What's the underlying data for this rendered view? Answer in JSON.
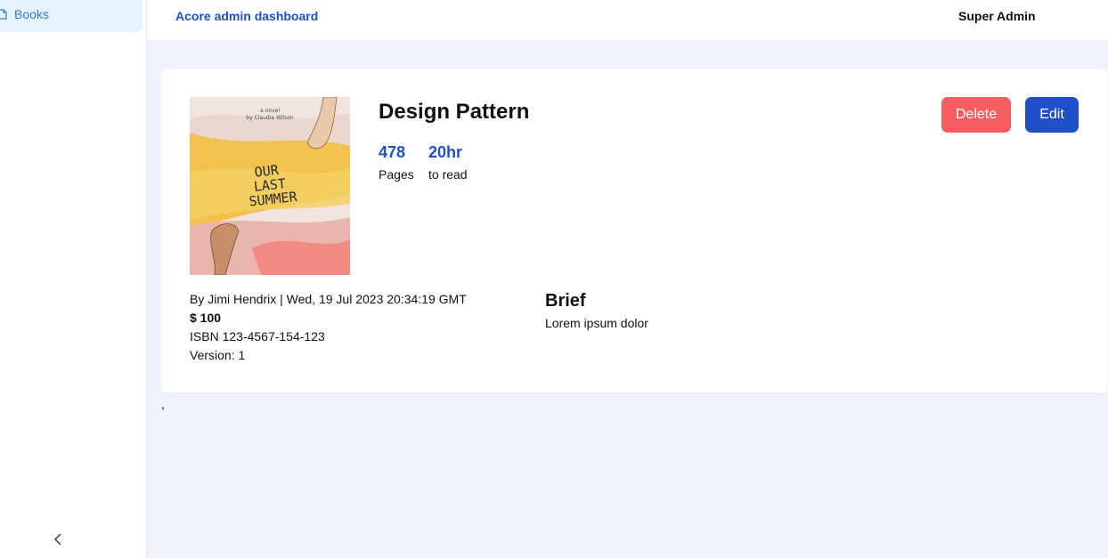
{
  "app": {
    "title": "Acore admin dashboard",
    "user": "Super Admin"
  },
  "sidebar": {
    "items": [
      {
        "label": "Books",
        "icon": "file-icon",
        "active": true
      }
    ],
    "collapse_icon": "chevron-left-icon"
  },
  "book": {
    "title": "Design Pattern",
    "stats": [
      {
        "value": "478",
        "caption": "Pages"
      },
      {
        "value": "20hr",
        "caption": "to read"
      }
    ],
    "cover": {
      "top_text_1": "a novel",
      "top_text_2": "by Claudia Wilson",
      "title_line_1": "OUR",
      "title_line_2": "LAST",
      "title_line_3": "SUMMER"
    },
    "byline": "By Jimi Hendrix | Wed, 19 Jul 2023 20:34:19 GMT",
    "price": "$ 100",
    "isbn": "ISBN 123-4567-154-123",
    "version": "Version: 1",
    "brief_title": "Brief",
    "brief_text": "Lorem ipsum dolor"
  },
  "actions": {
    "delete_label": "Delete",
    "edit_label": "Edit"
  },
  "stray_text": ",",
  "colors": {
    "accent": "#1f4fc7",
    "danger": "#f65e62",
    "background": "#eff1fb",
    "sidebar_active_bg": "#e6f2ff"
  }
}
